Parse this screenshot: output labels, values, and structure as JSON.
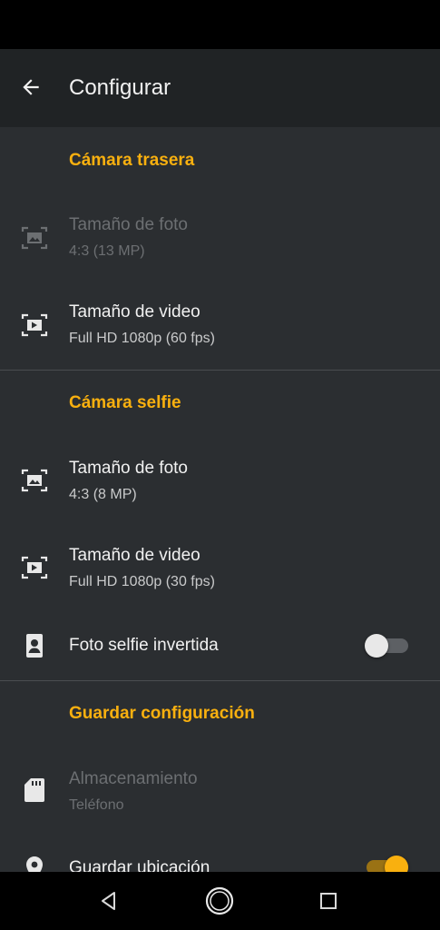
{
  "app_bar": {
    "title": "Configurar",
    "back_icon": "arrow-back-icon"
  },
  "sections": {
    "rear": {
      "header": "Cámara trasera",
      "photo_size": {
        "label": "Tamaño de foto",
        "value": "4:3 (13 MP)",
        "enabled": false,
        "icon": "photo-size-icon"
      },
      "video_size": {
        "label": "Tamaño de video",
        "value": "Full HD 1080p (60 fps)",
        "enabled": true,
        "icon": "video-size-icon"
      }
    },
    "selfie": {
      "header": "Cámara selfie",
      "photo_size": {
        "label": "Tamaño de foto",
        "value": "4:3 (8 MP)",
        "enabled": true,
        "icon": "photo-size-icon"
      },
      "video_size": {
        "label": "Tamaño de video",
        "value": "Full HD 1080p (30 fps)",
        "enabled": true,
        "icon": "video-size-icon"
      },
      "mirror": {
        "label": "Foto selfie invertida",
        "checked": false,
        "icon": "portrait-icon"
      }
    },
    "save": {
      "header": "Guardar configuración",
      "storage": {
        "label": "Almacenamiento",
        "value": "Teléfono",
        "enabled": false,
        "icon": "sd-card-icon"
      },
      "location": {
        "label": "Guardar ubicación",
        "checked": true,
        "icon": "location-pin-icon"
      }
    }
  },
  "colors": {
    "accent": "#f9b00f",
    "background": "#2b2e31",
    "app_bar": "#202325",
    "text_primary": "#f1f1f1",
    "text_disabled": "#6c6f72"
  },
  "nav_bar": {
    "back_icon": "nav-back-icon",
    "home_icon": "nav-home-icon",
    "recents_icon": "nav-recents-icon"
  }
}
